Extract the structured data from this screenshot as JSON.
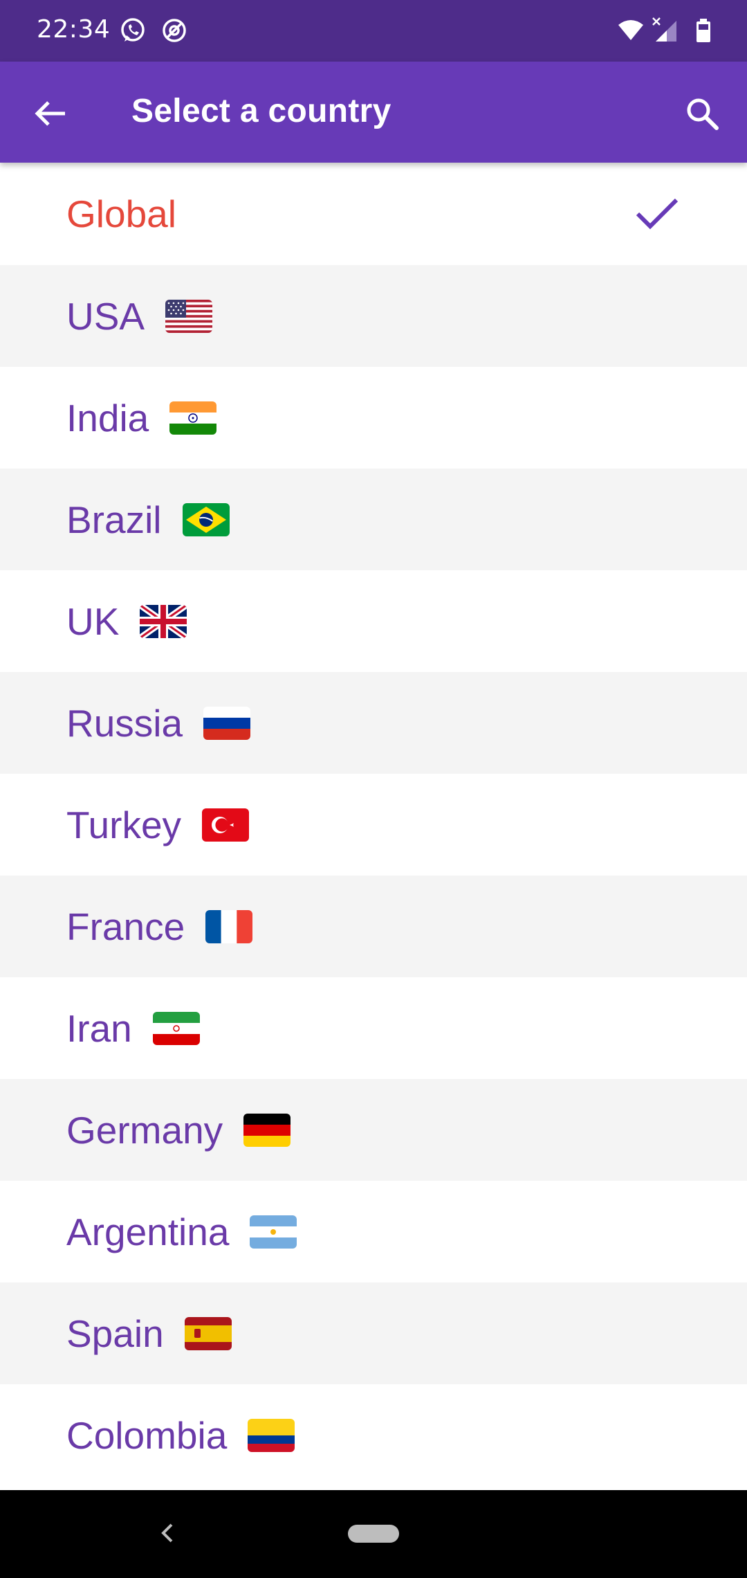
{
  "status_bar": {
    "time": "22:34",
    "icons": [
      "whatsapp-icon",
      "at-sign-icon",
      "wifi-icon",
      "cell-signal-icon",
      "battery-icon"
    ]
  },
  "app_bar": {
    "title": "Select a country",
    "back_icon": "arrow-back-icon",
    "search_icon": "search-icon",
    "color": "#673ab7"
  },
  "countries": [
    {
      "name": "Global",
      "selected": true,
      "flag": null
    },
    {
      "name": "USA",
      "flag": "us-flag-icon"
    },
    {
      "name": "India",
      "flag": "india-flag-icon"
    },
    {
      "name": "Brazil",
      "flag": "brazil-flag-icon"
    },
    {
      "name": "UK",
      "flag": "uk-flag-icon"
    },
    {
      "name": "Russia",
      "flag": "russia-flag-icon"
    },
    {
      "name": "Turkey",
      "flag": "turkey-flag-icon"
    },
    {
      "name": "France",
      "flag": "france-flag-icon"
    },
    {
      "name": "Iran",
      "flag": "iran-flag-icon"
    },
    {
      "name": "Germany",
      "flag": "germany-flag-icon"
    },
    {
      "name": "Argentina",
      "flag": "argentina-flag-icon"
    },
    {
      "name": "Spain",
      "flag": "spain-flag-icon"
    },
    {
      "name": "Colombia",
      "flag": "colombia-flag-icon"
    }
  ],
  "colors": {
    "item_text": "#6a3aa8",
    "selected_text": "#e5483b",
    "check": "#673ab7"
  }
}
